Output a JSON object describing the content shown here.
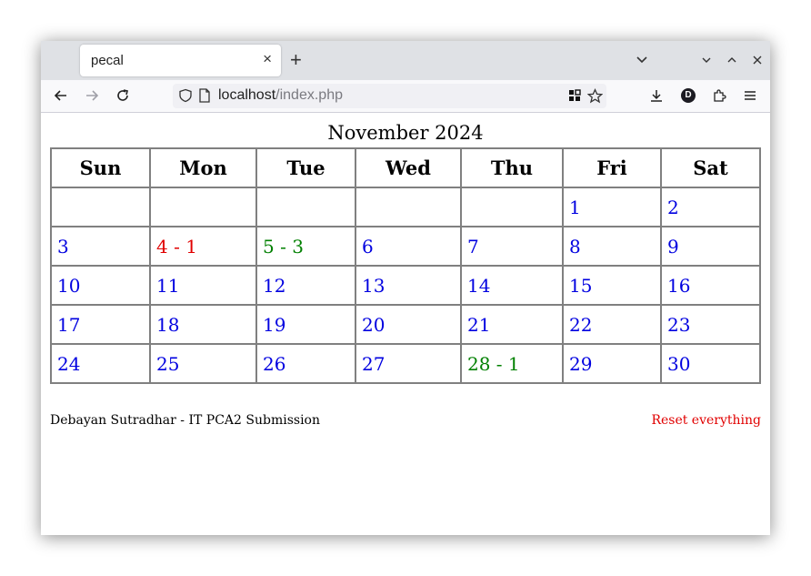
{
  "browser": {
    "tab_title": "pecal",
    "tab_close": "×",
    "new_tab": "+",
    "url_host": "localhost",
    "url_path": "/index.php",
    "profile_initial": "D"
  },
  "calendar": {
    "title": "November 2024",
    "weekdays": [
      "Sun",
      "Mon",
      "Tue",
      "Wed",
      "Thu",
      "Fri",
      "Sat"
    ],
    "weeks": [
      [
        {
          "text": "",
          "color": "#0000e0"
        },
        {
          "text": "",
          "color": "#0000e0"
        },
        {
          "text": "",
          "color": "#0000e0"
        },
        {
          "text": "",
          "color": "#0000e0"
        },
        {
          "text": "",
          "color": "#0000e0"
        },
        {
          "text": "1",
          "color": "#0000e0"
        },
        {
          "text": "2",
          "color": "#0000e0"
        }
      ],
      [
        {
          "text": "3",
          "color": "#0000e0"
        },
        {
          "text": "4 - 1",
          "color": "#e10000"
        },
        {
          "text": "5 - 3",
          "color": "#008000"
        },
        {
          "text": "6",
          "color": "#0000e0"
        },
        {
          "text": "7",
          "color": "#0000e0"
        },
        {
          "text": "8",
          "color": "#0000e0"
        },
        {
          "text": "9",
          "color": "#0000e0"
        }
      ],
      [
        {
          "text": "10",
          "color": "#0000e0"
        },
        {
          "text": "11",
          "color": "#0000e0"
        },
        {
          "text": "12",
          "color": "#0000e0"
        },
        {
          "text": "13",
          "color": "#0000e0"
        },
        {
          "text": "14",
          "color": "#0000e0"
        },
        {
          "text": "15",
          "color": "#0000e0"
        },
        {
          "text": "16",
          "color": "#0000e0"
        }
      ],
      [
        {
          "text": "17",
          "color": "#0000e0"
        },
        {
          "text": "18",
          "color": "#0000e0"
        },
        {
          "text": "19",
          "color": "#0000e0"
        },
        {
          "text": "20",
          "color": "#0000e0"
        },
        {
          "text": "21",
          "color": "#0000e0"
        },
        {
          "text": "22",
          "color": "#0000e0"
        },
        {
          "text": "23",
          "color": "#0000e0"
        }
      ],
      [
        {
          "text": "24",
          "color": "#0000e0"
        },
        {
          "text": "25",
          "color": "#0000e0"
        },
        {
          "text": "26",
          "color": "#0000e0"
        },
        {
          "text": "27",
          "color": "#0000e0"
        },
        {
          "text": "28 - 1",
          "color": "#008000"
        },
        {
          "text": "29",
          "color": "#0000e0"
        },
        {
          "text": "30",
          "color": "#0000e0"
        }
      ]
    ]
  },
  "footer": {
    "credit": "Debayan Sutradhar - IT PCA2 Submission",
    "reset_label": "Reset everything",
    "reset_color": "#e10000"
  }
}
